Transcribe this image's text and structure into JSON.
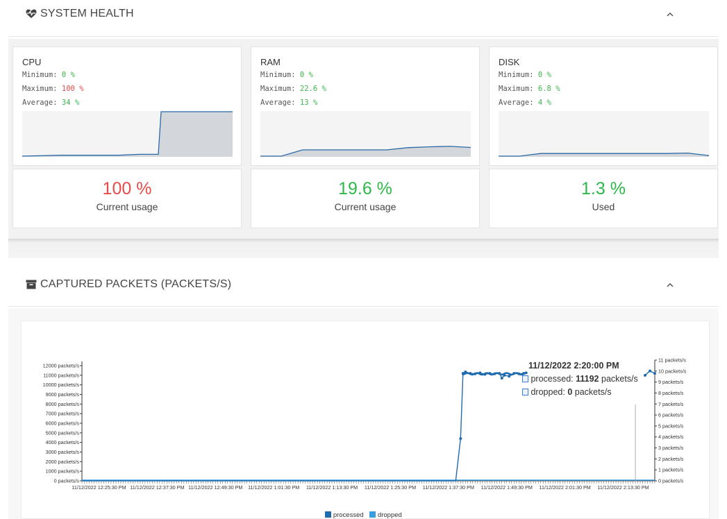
{
  "system_health": {
    "title": "SYSTEM HEALTH",
    "icon": "heartbeat-icon",
    "collapse_icon": "chevron-up-icon",
    "cards": [
      {
        "name": "CPU",
        "min_label": "Minimum:",
        "min": "0 %",
        "max_label": "Maximum:",
        "max": "100 %",
        "avg_label": "Average:",
        "avg": "34 %",
        "current": "100 %",
        "current_label": "Current usage",
        "spark": [
          0,
          1,
          2,
          2,
          2,
          2,
          4,
          4,
          100,
          100,
          100
        ],
        "value_color": "#e84a4a"
      },
      {
        "name": "RAM",
        "min_label": "Minimum:",
        "min": "0 %",
        "max_label": "Maximum:",
        "max": "22.6 %",
        "avg_label": "Average:",
        "avg": "13 %",
        "current": "19.6 %",
        "current_label": "Current usage",
        "spark": [
          0,
          0,
          14,
          14,
          14,
          14,
          14,
          19,
          21,
          22,
          19.6
        ],
        "value_color": "#2db84a"
      },
      {
        "name": "DISK",
        "min_label": "Minimum:",
        "min": "0 %",
        "max_label": "Maximum:",
        "max": "6.8 %",
        "avg_label": "Average:",
        "avg": "4 %",
        "current": "1.3 %",
        "current_label": "Used",
        "spark": [
          0,
          0,
          6,
          6,
          6,
          6,
          6,
          6,
          6,
          6.8,
          1.3
        ],
        "value_color": "#2db84a"
      }
    ]
  },
  "captured_packets": {
    "title": "CAPTURED PACKETS (PACKETS/S)",
    "icon": "archive-icon",
    "collapse_icon": "chevron-up-icon",
    "tooltip": {
      "datetime": "11/12/2022 2:20:00 PM",
      "processed_label": "processed:",
      "processed_value": "11192",
      "processed_unit": "packets/s",
      "dropped_label": "dropped:",
      "dropped_value": "0",
      "dropped_unit": "packets/s"
    },
    "legend": [
      "processed",
      "dropped"
    ],
    "colors": {
      "processed": "#1f6bad",
      "dropped": "#3a9de0"
    }
  },
  "chart_data": {
    "type": "line",
    "x_tick_labels": [
      "11/12/2022 12:25:30 PM",
      "11/12/2022 12:37:30 PM",
      "11/12/2022 12:49:30 PM",
      "11/12/2022 1:01:30 PM",
      "11/12/2022 1:13:30 PM",
      "11/12/2022 1:25:30 PM",
      "11/12/2022 1:37:30 PM",
      "11/12/2022 1:49:30 PM",
      "11/12/2022 2:01:30 PM",
      "11/12/2022 2:13:30 PM"
    ],
    "y_left_ticks": [
      "0 packets/s",
      "1000 packets/s",
      "2000 packets/s",
      "3000 packets/s",
      "4000 packets/s",
      "5000 packets/s",
      "6000 packets/s",
      "7000 packets/s",
      "8000 packets/s",
      "9000 packets/s",
      "10000 packets/s",
      "11000 packets/s",
      "12000 packets/s"
    ],
    "y_right_ticks": [
      "0 packets/s",
      "1 packets/s",
      "2 packets/s",
      "3 packets/s",
      "4 packets/s",
      "5 packets/s",
      "6 packets/s",
      "7 packets/s",
      "8 packets/s",
      "9 packets/s",
      "10 packets/s",
      "11 packets/s"
    ],
    "ylim_left": [
      0,
      12000
    ],
    "ylim_right": [
      0,
      11
    ],
    "series": [
      {
        "name": "processed",
        "axis": "left",
        "points": [
          [
            "12:22:00 PM",
            0
          ],
          [
            "1:39:00 PM",
            0
          ],
          [
            "1:40:00 PM",
            4400
          ],
          [
            "1:40:30 PM",
            11200
          ],
          [
            "1:41:00 PM",
            11350
          ],
          [
            "1:42:00 PM",
            11200
          ],
          [
            "1:43:00 PM",
            11150
          ],
          [
            "1:44:00 PM",
            11250
          ],
          [
            "1:45:00 PM",
            11100
          ],
          [
            "1:46:00 PM",
            11200
          ],
          [
            "1:47:00 PM",
            11150
          ],
          [
            "1:48:00 PM",
            11200
          ],
          [
            "1:48:30 PM",
            10700
          ],
          [
            "1:49:00 PM",
            11000
          ],
          [
            "1:50:00 PM",
            10900
          ],
          [
            "1:51:00 PM",
            11200
          ],
          [
            "1:52:00 PM",
            11150
          ],
          [
            "1:53:00 PM",
            11200
          ],
          [
            "1:53:30 PM",
            11250
          ],
          [
            "2:18:00 PM",
            11000
          ],
          [
            "2:19:00 PM",
            11450
          ],
          [
            "2:20:00 PM",
            11192
          ]
        ]
      },
      {
        "name": "dropped",
        "axis": "right",
        "points": [
          [
            "12:22:00 PM",
            0
          ],
          [
            "2:20:00 PM",
            0
          ]
        ]
      }
    ],
    "legend_position": "bottom",
    "grid": false
  }
}
